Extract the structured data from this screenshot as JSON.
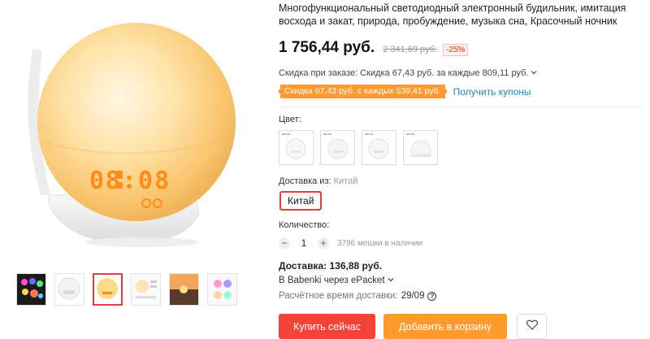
{
  "product": {
    "title": "Многофункциональный светодиодный электронный будильник, имитация восхода и закат, природа, пробуждение, музыка сна, Красочный ночник",
    "price": "1 756,44 руб.",
    "old_price": "2 341,69 руб.",
    "discount": "-25%",
    "clock_display": "08:08"
  },
  "promotions": {
    "order_discount": "Скидка при заказе: Скидка 67,43 руб. за каждые 809,11 руб.",
    "coupon_tag": "Скидка 67,43 руб. с каждых 539,41 руб.",
    "coupon_link": "Получить купоны"
  },
  "options": {
    "color_label": "Цвет:",
    "ship_from_label": "Доставка из:",
    "ship_from_value": "Китай",
    "country_selected": "Китай",
    "quantity_label": "Количество:",
    "quantity_value": "1",
    "stock_text": "3796 мешки в наличии"
  },
  "shipping": {
    "delivery": "Доставка: 136,88 руб.",
    "carrier": "В Babenki через ePacket",
    "eta_label": "Расчётное время доставки:",
    "eta_value": "29/09"
  },
  "actions": {
    "buy_now": "Купить сейчас",
    "add_to_cart": "Добавить в корзину"
  },
  "colors": {
    "buy": "#f44336",
    "cart": "#ff9a2e",
    "coupon": "#ff9a2e",
    "link": "#1e88b6",
    "selected": "#e63c3c",
    "clock_digits": "#ff8c1a"
  }
}
